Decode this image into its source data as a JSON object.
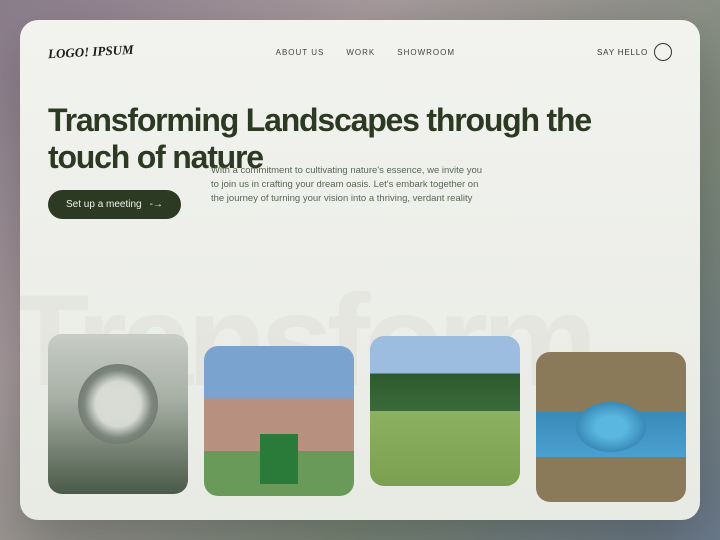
{
  "logo": "LOGO! IPSUM",
  "nav": {
    "links": [
      "ABOUT US",
      "WORK",
      "SHOWROOM"
    ],
    "cta": "SAY HELLO"
  },
  "hero": {
    "headline": "Transforming Landscapes through the touch of nature",
    "cta_label": "Set up a meeting",
    "subtext": "With a commitment to cultivating nature's essence, we invite you to join us in crafting your dream oasis. Let's embark together on the journey of turning your vision into a thriving, verdant reality"
  },
  "watermark": "Transform"
}
